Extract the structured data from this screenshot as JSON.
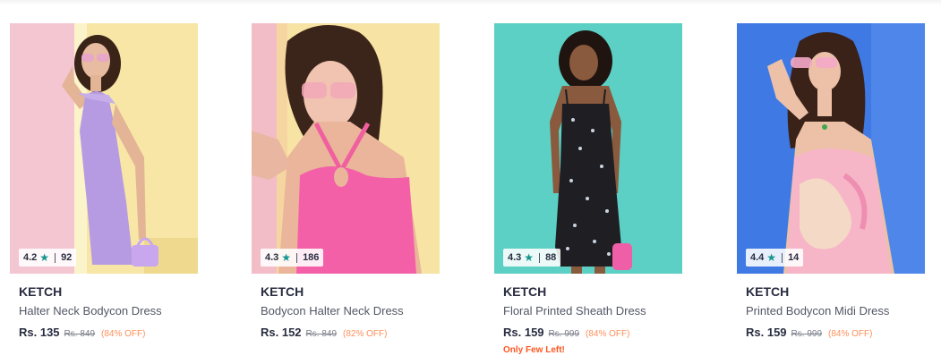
{
  "products": [
    {
      "brand": "KETCH",
      "title": "Halter Neck Bodycon Dress",
      "rating": "4.2",
      "reviews": "92",
      "price": "Rs. 135",
      "mrp": "Rs. 849",
      "discount": "(84% OFF)",
      "urgency": "",
      "star_color": "#14958f"
    },
    {
      "brand": "KETCH",
      "title": "Bodycon Halter Neck Dress",
      "rating": "4.3",
      "reviews": "186",
      "price": "Rs. 152",
      "mrp": "Rs. 849",
      "discount": "(82% OFF)",
      "urgency": "",
      "star_color": "#14958f"
    },
    {
      "brand": "KETCH",
      "title": "Floral Printed Sheath Dress",
      "rating": "4.3",
      "reviews": "88",
      "price": "Rs. 159",
      "mrp": "Rs. 999",
      "discount": "(84% OFF)",
      "urgency": "Only Few Left!",
      "star_color": "#14958f"
    },
    {
      "brand": "KETCH",
      "title": "Printed Bodycon Midi Dress",
      "rating": "4.4",
      "reviews": "14",
      "price": "Rs. 159",
      "mrp": "Rs. 999",
      "discount": "(84% OFF)",
      "urgency": "",
      "star_color": "#14958f"
    }
  ],
  "icons": {
    "rating": "star-icon"
  },
  "colors": {
    "discount": "#ff905a",
    "urgency": "#ff5722",
    "star": "#14958f"
  }
}
